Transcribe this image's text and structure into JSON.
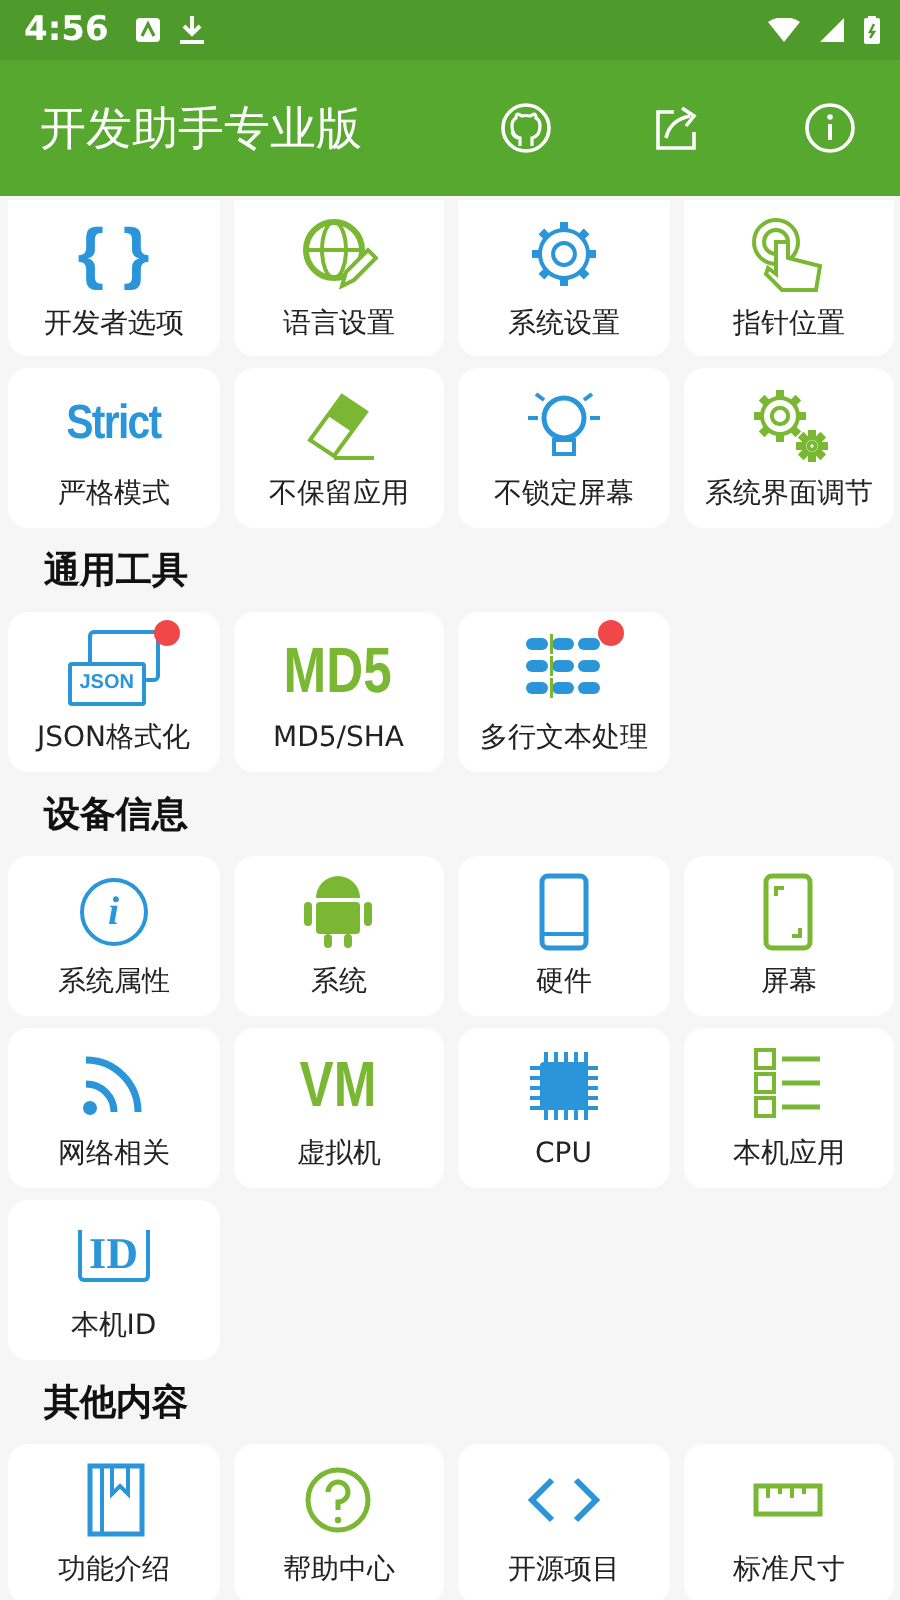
{
  "status_bar": {
    "time": "4:56"
  },
  "app_bar": {
    "title": "开发助手专业版"
  },
  "sections": [
    {
      "items": [
        {
          "label": "开发者选项",
          "badge": false,
          "icon_text": "{ }"
        },
        {
          "label": "语言设置",
          "badge": false
        },
        {
          "label": "系统设置",
          "badge": false
        },
        {
          "label": "指针位置",
          "badge": false
        },
        {
          "label": "严格模式",
          "badge": false,
          "icon_text": "Strict"
        },
        {
          "label": "不保留应用",
          "badge": false
        },
        {
          "label": "不锁定屏幕",
          "badge": false
        },
        {
          "label": "系统界面调节",
          "badge": false
        }
      ]
    },
    {
      "title": "通用工具",
      "items": [
        {
          "label": "JSON格式化",
          "badge": true,
          "icon_text": "JSON"
        },
        {
          "label": "MD5/SHA",
          "badge": false,
          "icon_text": "MD5"
        },
        {
          "label": "多行文本处理",
          "badge": true
        }
      ]
    },
    {
      "title": "设备信息",
      "items": [
        {
          "label": "系统属性",
          "badge": false,
          "icon_text": "i"
        },
        {
          "label": "系统",
          "badge": false
        },
        {
          "label": "硬件",
          "badge": false
        },
        {
          "label": "屏幕",
          "badge": false
        },
        {
          "label": "网络相关",
          "badge": false
        },
        {
          "label": "虚拟机",
          "badge": false,
          "icon_text": "VM"
        },
        {
          "label": "CPU",
          "badge": false
        },
        {
          "label": "本机应用",
          "badge": false
        },
        {
          "label": "本机ID",
          "badge": false,
          "icon_text": "ID"
        }
      ]
    },
    {
      "title": "其他内容",
      "items": [
        {
          "label": "功能介绍",
          "badge": false
        },
        {
          "label": "帮助中心",
          "badge": false
        },
        {
          "label": "开源项目",
          "badge": false
        },
        {
          "label": "标准尺寸",
          "badge": false
        }
      ]
    }
  ]
}
